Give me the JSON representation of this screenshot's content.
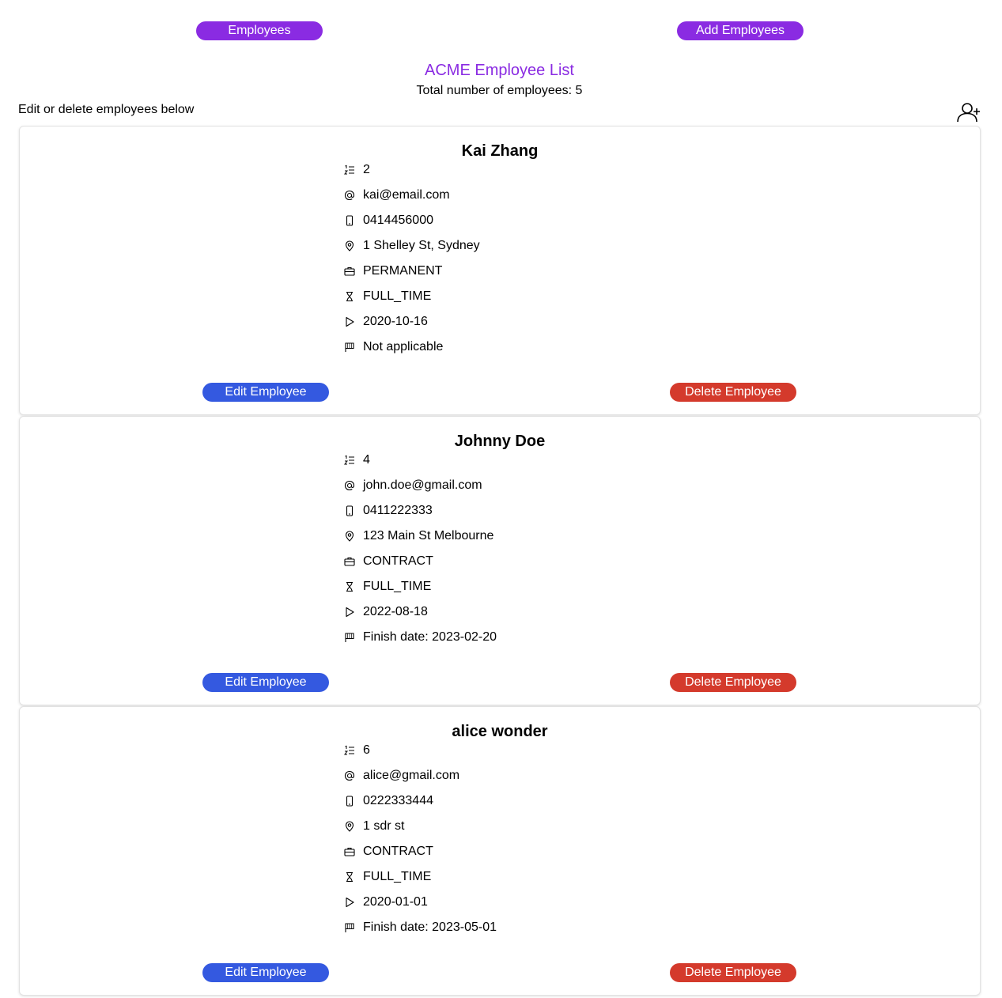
{
  "colors": {
    "purple": "#8a2be2",
    "edit_blue": "#3459e0",
    "delete_red": "#d43a2c"
  },
  "nav": {
    "employees_label": "Employees",
    "add_label": "Add Employees"
  },
  "header": {
    "title": "ACME Employee List",
    "total": "Total number of employees: 5",
    "instructions": "Edit or delete employees below",
    "add_icon": "user-plus-icon"
  },
  "employees": [
    {
      "name": "Kai Zhang",
      "id": "2",
      "email": "kai@email.com",
      "phone": "0414456000",
      "address": "1 Shelley St, Sydney",
      "contract": "PERMANENT",
      "hours": "FULL_TIME",
      "start": "2020-10-16",
      "finish": "Not applicable",
      "edit_label": "Edit Employee",
      "delete_label": "Delete Employee"
    },
    {
      "name": "Johnny Doe",
      "id": "4",
      "email": "john.doe@gmail.com",
      "phone": "0411222333",
      "address": "123 Main St Melbourne",
      "contract": "CONTRACT",
      "hours": "FULL_TIME",
      "start": "2022-08-18",
      "finish": "Finish date: 2023-02-20",
      "edit_label": "Edit Employee",
      "delete_label": "Delete Employee"
    },
    {
      "name": "alice wonder",
      "id": "6",
      "email": "alice@gmail.com",
      "phone": "0222333444",
      "address": "1 sdr st",
      "contract": "CONTRACT",
      "hours": "FULL_TIME",
      "start": "2020-01-01",
      "finish": "Finish date: 2023-05-01",
      "edit_label": "Edit Employee",
      "delete_label": "Delete Employee"
    }
  ],
  "icons": {
    "id": "numbered-list-icon",
    "email": "at-sign-icon",
    "phone": "mobile-phone-icon",
    "address": "map-pin-icon",
    "contract": "briefcase-icon",
    "hours": "hourglass-icon",
    "start": "play-icon",
    "finish": "flag-icon"
  }
}
